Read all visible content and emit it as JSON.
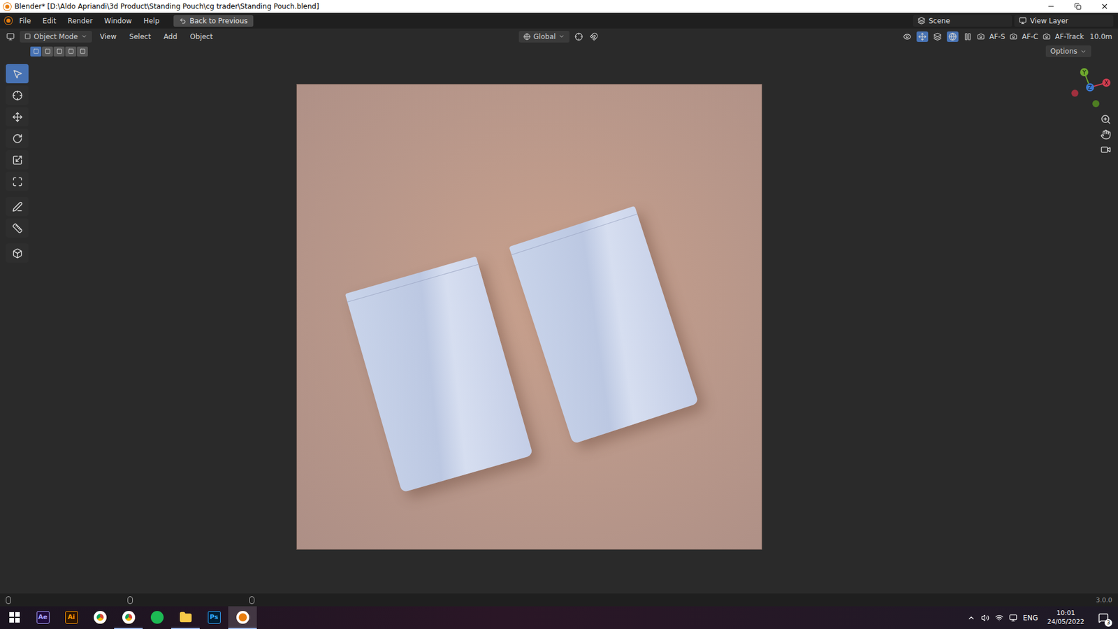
{
  "window": {
    "title": "Blender* [D:\\Aldo Apriandi\\3d Product\\Standing Pouch\\cg trader\\Standing Pouch.blend]"
  },
  "menu": [
    "File",
    "Edit",
    "Render",
    "Window",
    "Help"
  ],
  "back_button": "Back to Previous",
  "scene": "Scene",
  "view_layer": "View Layer",
  "header": {
    "mode": "Object Mode",
    "menus": [
      "View",
      "Select",
      "Add",
      "Object"
    ],
    "orientation": "Global",
    "right": [
      "AF-S",
      "AF-C",
      "AF-Track",
      "10.0m"
    ]
  },
  "select_modes": [
    {
      "selected": true
    },
    {
      "selected": false
    },
    {
      "selected": false
    },
    {
      "selected": false
    },
    {
      "selected": false
    }
  ],
  "options": "Options",
  "tools": [
    {
      "selected": true
    },
    {
      "selected": false
    },
    {
      "selected": false
    },
    {
      "selected": false
    },
    {
      "selected": false
    },
    {
      "selected": false
    },
    {
      "selected": false
    },
    {
      "selected": false
    },
    {
      "selected": false
    }
  ],
  "gizmo": {
    "axes": [
      "Y",
      "Z",
      "X"
    ]
  },
  "status_bar": {
    "version": "3.0.0"
  },
  "taskbar": {
    "apps": [
      {
        "kind": "windows",
        "running": false,
        "selected": false
      },
      {
        "kind": "ae",
        "label": "Ae",
        "running": false,
        "selected": false
      },
      {
        "kind": "ai",
        "label": "Ai",
        "running": false,
        "selected": false
      },
      {
        "kind": "chrome",
        "running": false,
        "selected": false
      },
      {
        "kind": "chrome",
        "running": true,
        "selected": false
      },
      {
        "kind": "spotify",
        "running": false,
        "selected": false
      },
      {
        "kind": "explorer",
        "running": true,
        "selected": false
      },
      {
        "kind": "ps",
        "label": "Ps",
        "running": false,
        "selected": false
      },
      {
        "kind": "blender",
        "running": true,
        "selected": true
      }
    ]
  },
  "tray": {
    "language": "ENG",
    "time": "10:01",
    "date": "24/05/2022",
    "notifications": "3"
  }
}
